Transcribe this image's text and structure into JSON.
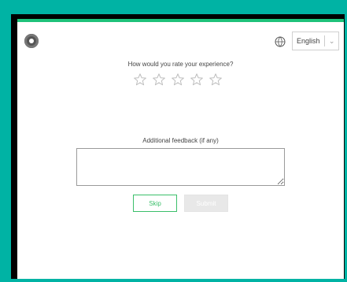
{
  "header": {
    "logo_icon": "camera-lens-icon",
    "language_icon": "globe-icon",
    "language_selected": "English",
    "language_chevron_icon": "chevron-down-icon"
  },
  "rating": {
    "question": "How would you rate your experience?",
    "star_icon": "star-outline-icon",
    "max_stars": 5,
    "selected_stars": 0
  },
  "feedback": {
    "label": "Additional feedback (if any)",
    "value": "",
    "placeholder": ""
  },
  "actions": {
    "skip_label": "Skip",
    "submit_label": "Submit"
  },
  "colors": {
    "frame_border": "#00b3a4",
    "accent_green": "#3bbf6a",
    "top_bar_green": "#1ec27a",
    "submit_disabled_bg": "#e8e8e8"
  }
}
